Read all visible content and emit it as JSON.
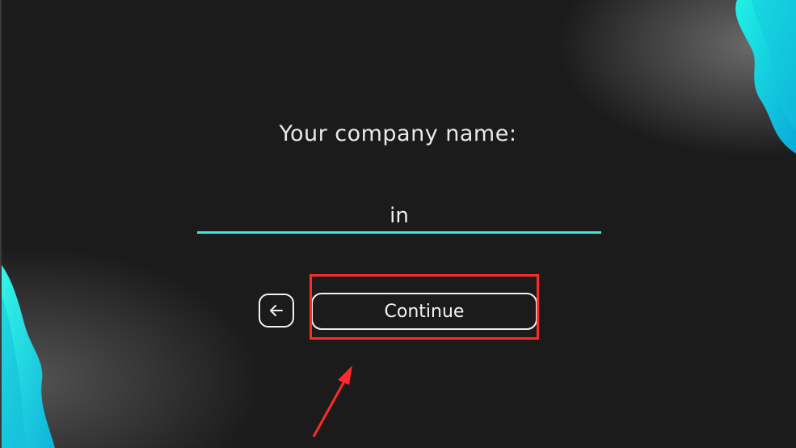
{
  "screen": {
    "prompt_label": "Your company name:",
    "company_name_value": "in",
    "continue_label": "Continue",
    "back_icon": "arrow-left-icon"
  },
  "colors": {
    "background": "#1b1b1c",
    "accent": "#3ee6e0",
    "text": "#e9e9e9",
    "annotation": "#ff2a2a"
  }
}
